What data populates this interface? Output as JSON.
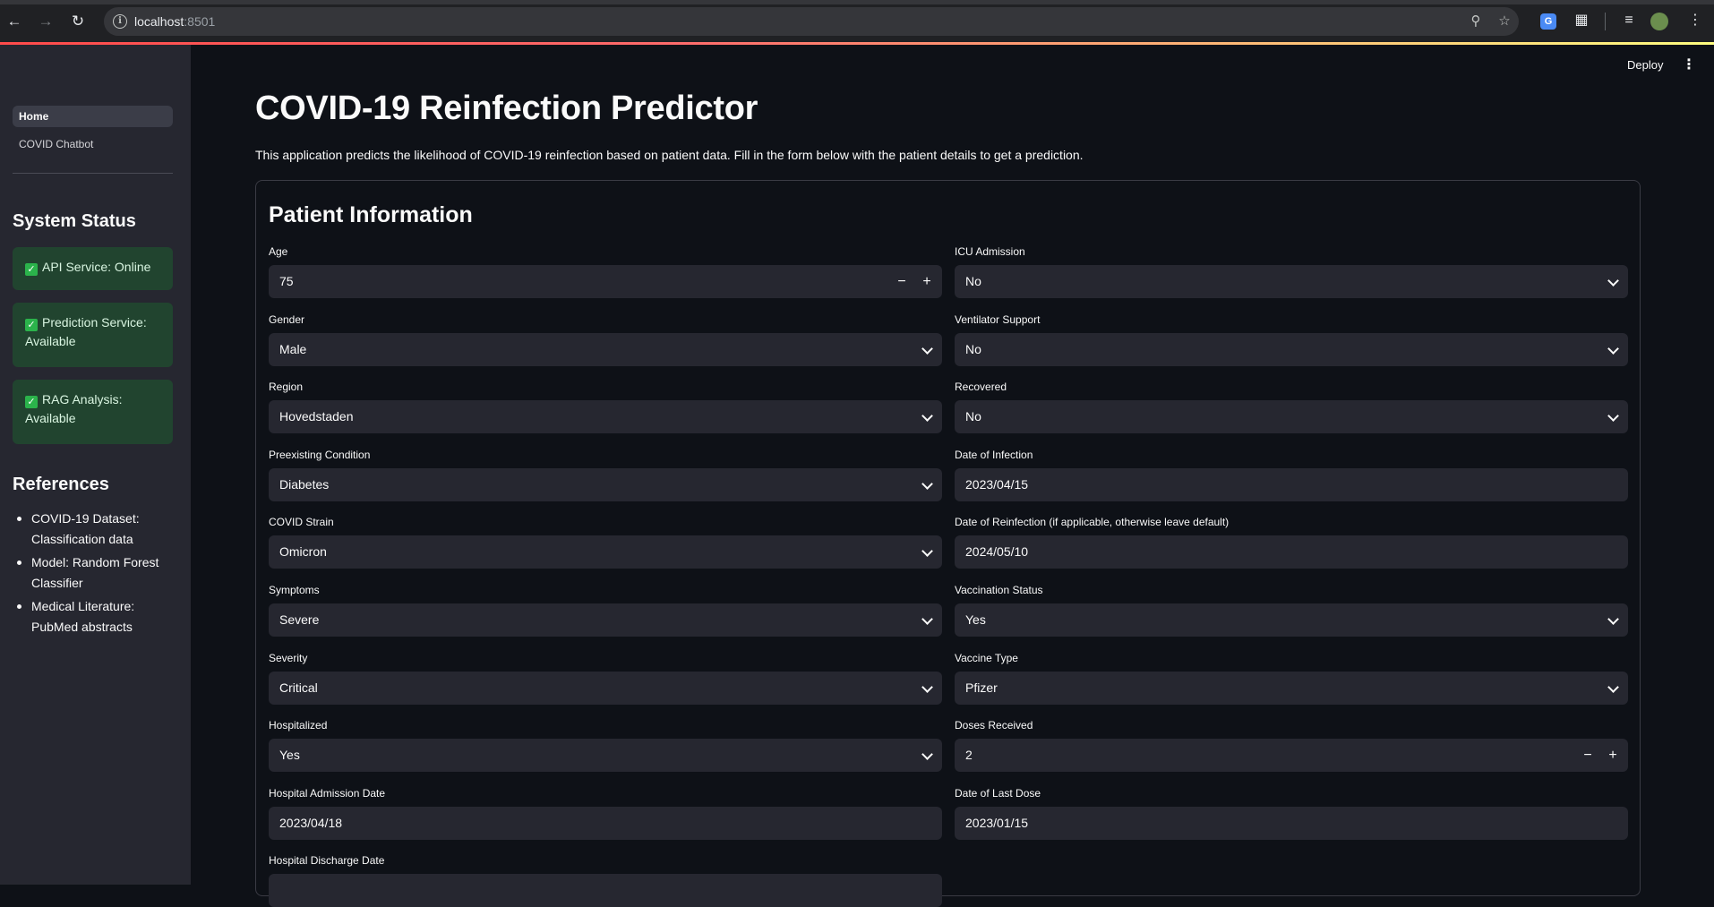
{
  "browser": {
    "url_host": "localhost",
    "url_port": ":8501",
    "back_icon": "arrow-left-icon",
    "forward_icon": "arrow-right-icon",
    "reload_icon": "reload-icon"
  },
  "sidebar": {
    "nav": [
      {
        "label": "Home",
        "active": true
      },
      {
        "label": "COVID Chatbot",
        "active": false
      }
    ],
    "system_status_title": "System Status",
    "statuses": [
      {
        "label": "API Service: Online"
      },
      {
        "label": "Prediction Service: Available"
      },
      {
        "label": "RAG Analysis: Available"
      }
    ],
    "references_title": "References",
    "references": [
      "COVID-19 Dataset: Classification data",
      "Model: Random Forest Classifier",
      "Medical Literature: PubMed abstracts"
    ]
  },
  "header": {
    "deploy_label": "Deploy"
  },
  "main": {
    "title": "COVID-19 Reinfection Predictor",
    "description": "This application predicts the likelihood of COVID-19 reinfection based on patient data. Fill in the form below with the patient details to get a prediction.",
    "form_title": "Patient Information",
    "left_fields": [
      {
        "label": "Age",
        "value": "75",
        "type": "number"
      },
      {
        "label": "Gender",
        "value": "Male",
        "type": "select"
      },
      {
        "label": "Region",
        "value": "Hovedstaden",
        "type": "select"
      },
      {
        "label": "Preexisting Condition",
        "value": "Diabetes",
        "type": "select"
      },
      {
        "label": "COVID Strain",
        "value": "Omicron",
        "type": "select"
      },
      {
        "label": "Symptoms",
        "value": "Severe",
        "type": "select"
      },
      {
        "label": "Severity",
        "value": "Critical",
        "type": "select"
      },
      {
        "label": "Hospitalized",
        "value": "Yes",
        "type": "select"
      },
      {
        "label": "Hospital Admission Date",
        "value": "2023/04/18",
        "type": "date"
      },
      {
        "label": "Hospital Discharge Date",
        "value": "",
        "type": "date"
      }
    ],
    "right_fields": [
      {
        "label": "ICU Admission",
        "value": "No",
        "type": "select"
      },
      {
        "label": "Ventilator Support",
        "value": "No",
        "type": "select"
      },
      {
        "label": "Recovered",
        "value": "No",
        "type": "select"
      },
      {
        "label": "Date of Infection",
        "value": "2023/04/15",
        "type": "date"
      },
      {
        "label": "Date of Reinfection (if applicable, otherwise leave default)",
        "value": "2024/05/10",
        "type": "date"
      },
      {
        "label": "Vaccination Status",
        "value": "Yes",
        "type": "select"
      },
      {
        "label": "Vaccine Type",
        "value": "Pfizer",
        "type": "select"
      },
      {
        "label": "Doses Received",
        "value": "2",
        "type": "number"
      },
      {
        "label": "Date of Last Dose",
        "value": "2023/01/15",
        "type": "date"
      }
    ]
  },
  "colors": {
    "page_bg": "#0e1117",
    "sidebar_bg": "#262730",
    "input_bg": "#262730",
    "status_bg": "#21442f",
    "accent": "#ff4b4b"
  }
}
